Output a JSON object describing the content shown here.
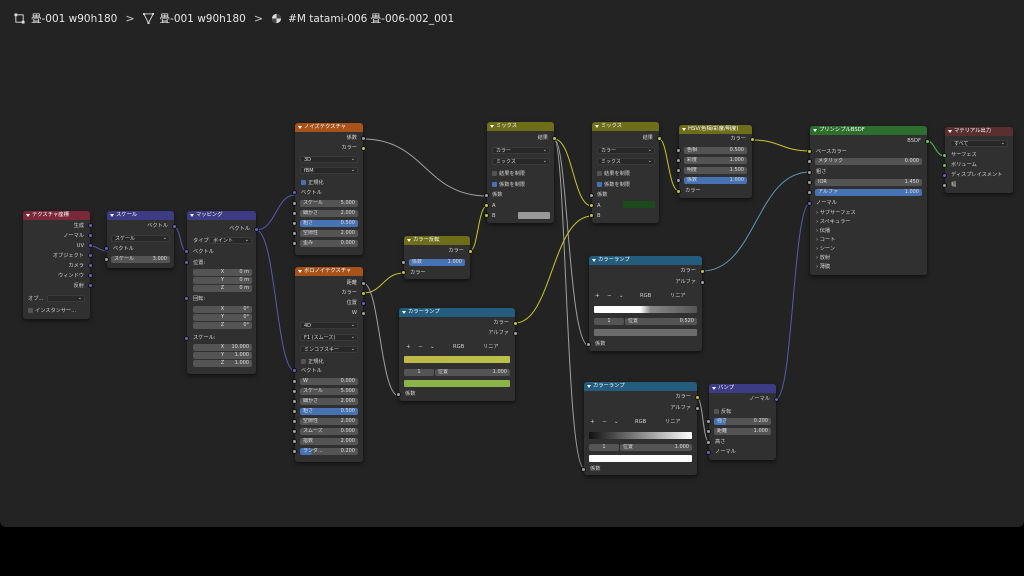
{
  "breadcrumb": {
    "object": "畳-001 w90h180",
    "mesh": "畳-001 w90h180",
    "material": "#M tatami-006 畳-006-002_001",
    "separator": ">"
  },
  "nodes": {
    "texcoord": {
      "title": "テクスチャ座標",
      "outputs": [
        "生成",
        "ノーマル",
        "UV",
        "オブジェクト",
        "カメラ",
        "ウィンドウ",
        "反射"
      ],
      "object_label": "オブ...",
      "instancer": "インスタンサー..."
    },
    "scale": {
      "title": "スケール",
      "out": "ベクトル",
      "op": "スケール",
      "in_vec": "ベクトル",
      "scale_label": "スケール",
      "scale_value": "3.000"
    },
    "mapping": {
      "title": "マッピング",
      "out": "ベクトル",
      "type_label": "タイプ:",
      "type_value": "ポイント",
      "in_vec": "ベクトル",
      "loc": "位置:",
      "rot": "回転:",
      "scl": "スケール:",
      "loc_rows": [
        {
          "k": "X",
          "v": "0 m"
        },
        {
          "k": "Y",
          "v": "0 m"
        },
        {
          "k": "Z",
          "v": "0 m"
        }
      ],
      "rot_rows": [
        {
          "k": "X",
          "v": "0°"
        },
        {
          "k": "Y",
          "v": "0°"
        },
        {
          "k": "Z",
          "v": "0°"
        }
      ],
      "scl_rows": [
        {
          "k": "X",
          "v": "10.000"
        },
        {
          "k": "Y",
          "v": "1.000"
        },
        {
          "k": "Z",
          "v": "1.000"
        }
      ]
    },
    "noise": {
      "title": "ノイズテクスチャ",
      "out_fac": "係数",
      "out_col": "カラー",
      "dim": "3D",
      "type": "fBM",
      "normalize": "正規化",
      "in_vec": "ベクトル",
      "rows": [
        {
          "k": "スケール",
          "v": "5.000"
        },
        {
          "k": "細かさ",
          "v": "2.000"
        },
        {
          "k": "粗さ",
          "v": "0.500"
        },
        {
          "k": "空隙性",
          "v": "2.000"
        },
        {
          "k": "歪み",
          "v": "0.000"
        }
      ]
    },
    "voronoi": {
      "title": "ボロノイテクスチャ",
      "outs": [
        "距離",
        "カラー",
        "位置",
        "W"
      ],
      "dim": "4D",
      "feature": "F1 (スムーズ)",
      "metric": "ミンコフスキー",
      "normalize": "正規化",
      "in_vec": "ベクトル",
      "rows": [
        {
          "k": "W",
          "v": "0.000"
        },
        {
          "k": "スケール",
          "v": "5.000"
        },
        {
          "k": "細かさ",
          "v": "2.000"
        },
        {
          "k": "粗さ",
          "v": "0.500"
        },
        {
          "k": "空隙性",
          "v": "2.000"
        },
        {
          "k": "スムーズ",
          "v": "0.000"
        },
        {
          "k": "指数",
          "v": "2.000"
        },
        {
          "k": "ランダ...",
          "v": "0.200"
        }
      ]
    },
    "invert": {
      "title": "カラー反転",
      "out": "カラー",
      "fac_label": "係数",
      "fac_value": "1.000",
      "in_col": "カラー"
    },
    "ramp1": {
      "title": "カラーランプ",
      "out_col": "カラー",
      "out_alpha": "アルファ",
      "mode": "RGB",
      "interp": "リニア",
      "index": "1",
      "pos_label": "位置",
      "pos_value": "1.000",
      "in_fac": "係数"
    },
    "mix1": {
      "title": "ミックス",
      "out": "結果",
      "type": "カラー",
      "blend": "ミックス",
      "clamp_result": "結果を制限",
      "clamp_factor": "係数を制限",
      "in_fac": "係数",
      "in_a": "A",
      "in_b": "B"
    },
    "mix2": {
      "title": "ミックス",
      "out": "結果",
      "type": "カラー",
      "blend": "ミックス",
      "clamp_result": "結果を制限",
      "clamp_factor": "係数を制限",
      "in_fac": "係数",
      "in_a": "A",
      "in_b": "B"
    },
    "hsv": {
      "title": "HSV(色相/彩度/明度)",
      "out": "カラー",
      "rows": [
        {
          "k": "色相",
          "v": "0.500"
        },
        {
          "k": "彩度",
          "v": "1.000"
        },
        {
          "k": "明度",
          "v": "1.500"
        },
        {
          "k": "係数",
          "v": "1.000"
        }
      ],
      "in_col": "カラー"
    },
    "ramp2": {
      "title": "カラーランプ",
      "out_col": "カラー",
      "out_alpha": "アルファ",
      "mode": "RGB",
      "interp": "リニア",
      "index": "1",
      "pos_label": "位置",
      "pos_value": "0.520",
      "in_fac": "係数"
    },
    "ramp3": {
      "title": "カラーランプ",
      "out_col": "カラー",
      "out_alpha": "アルファ",
      "mode": "RGB",
      "interp": "リニア",
      "index": "1",
      "pos_label": "位置",
      "pos_value": "1.000",
      "in_fac": "係数"
    },
    "bump": {
      "title": "バンプ",
      "out": "ノーマル",
      "invert": "反転",
      "rows": [
        {
          "k": "強さ",
          "v": "0.200"
        },
        {
          "k": "距離",
          "v": "1.000"
        }
      ],
      "height": "高さ",
      "normal": "ノーマル"
    },
    "bsdf": {
      "title": "プリンシプルBSDF",
      "out": "BSDF",
      "base": "ベースカラー",
      "metallic_label": "メタリック",
      "metallic_value": "0.000",
      "rough": "粗さ",
      "ior_label": "IOR",
      "ior_value": "1.450",
      "alpha_label": "アルファ",
      "alpha_value": "1.000",
      "normal": "ノーマル",
      "panels": [
        "サブサーフェス",
        "スペキュラー",
        "伝播",
        "コート",
        "シーン",
        "放射",
        "薄膜"
      ]
    },
    "output": {
      "title": "マテリアル出力",
      "target": "すべて",
      "inputs": [
        "サーフェス",
        "ボリューム",
        "ディスプレイスメント",
        "幅"
      ]
    }
  },
  "colors": {
    "color_socket": "#c7c729",
    "float_socket": "#a1a1a1",
    "vector_socket": "#6363c7",
    "shader_socket": "#63c763"
  }
}
